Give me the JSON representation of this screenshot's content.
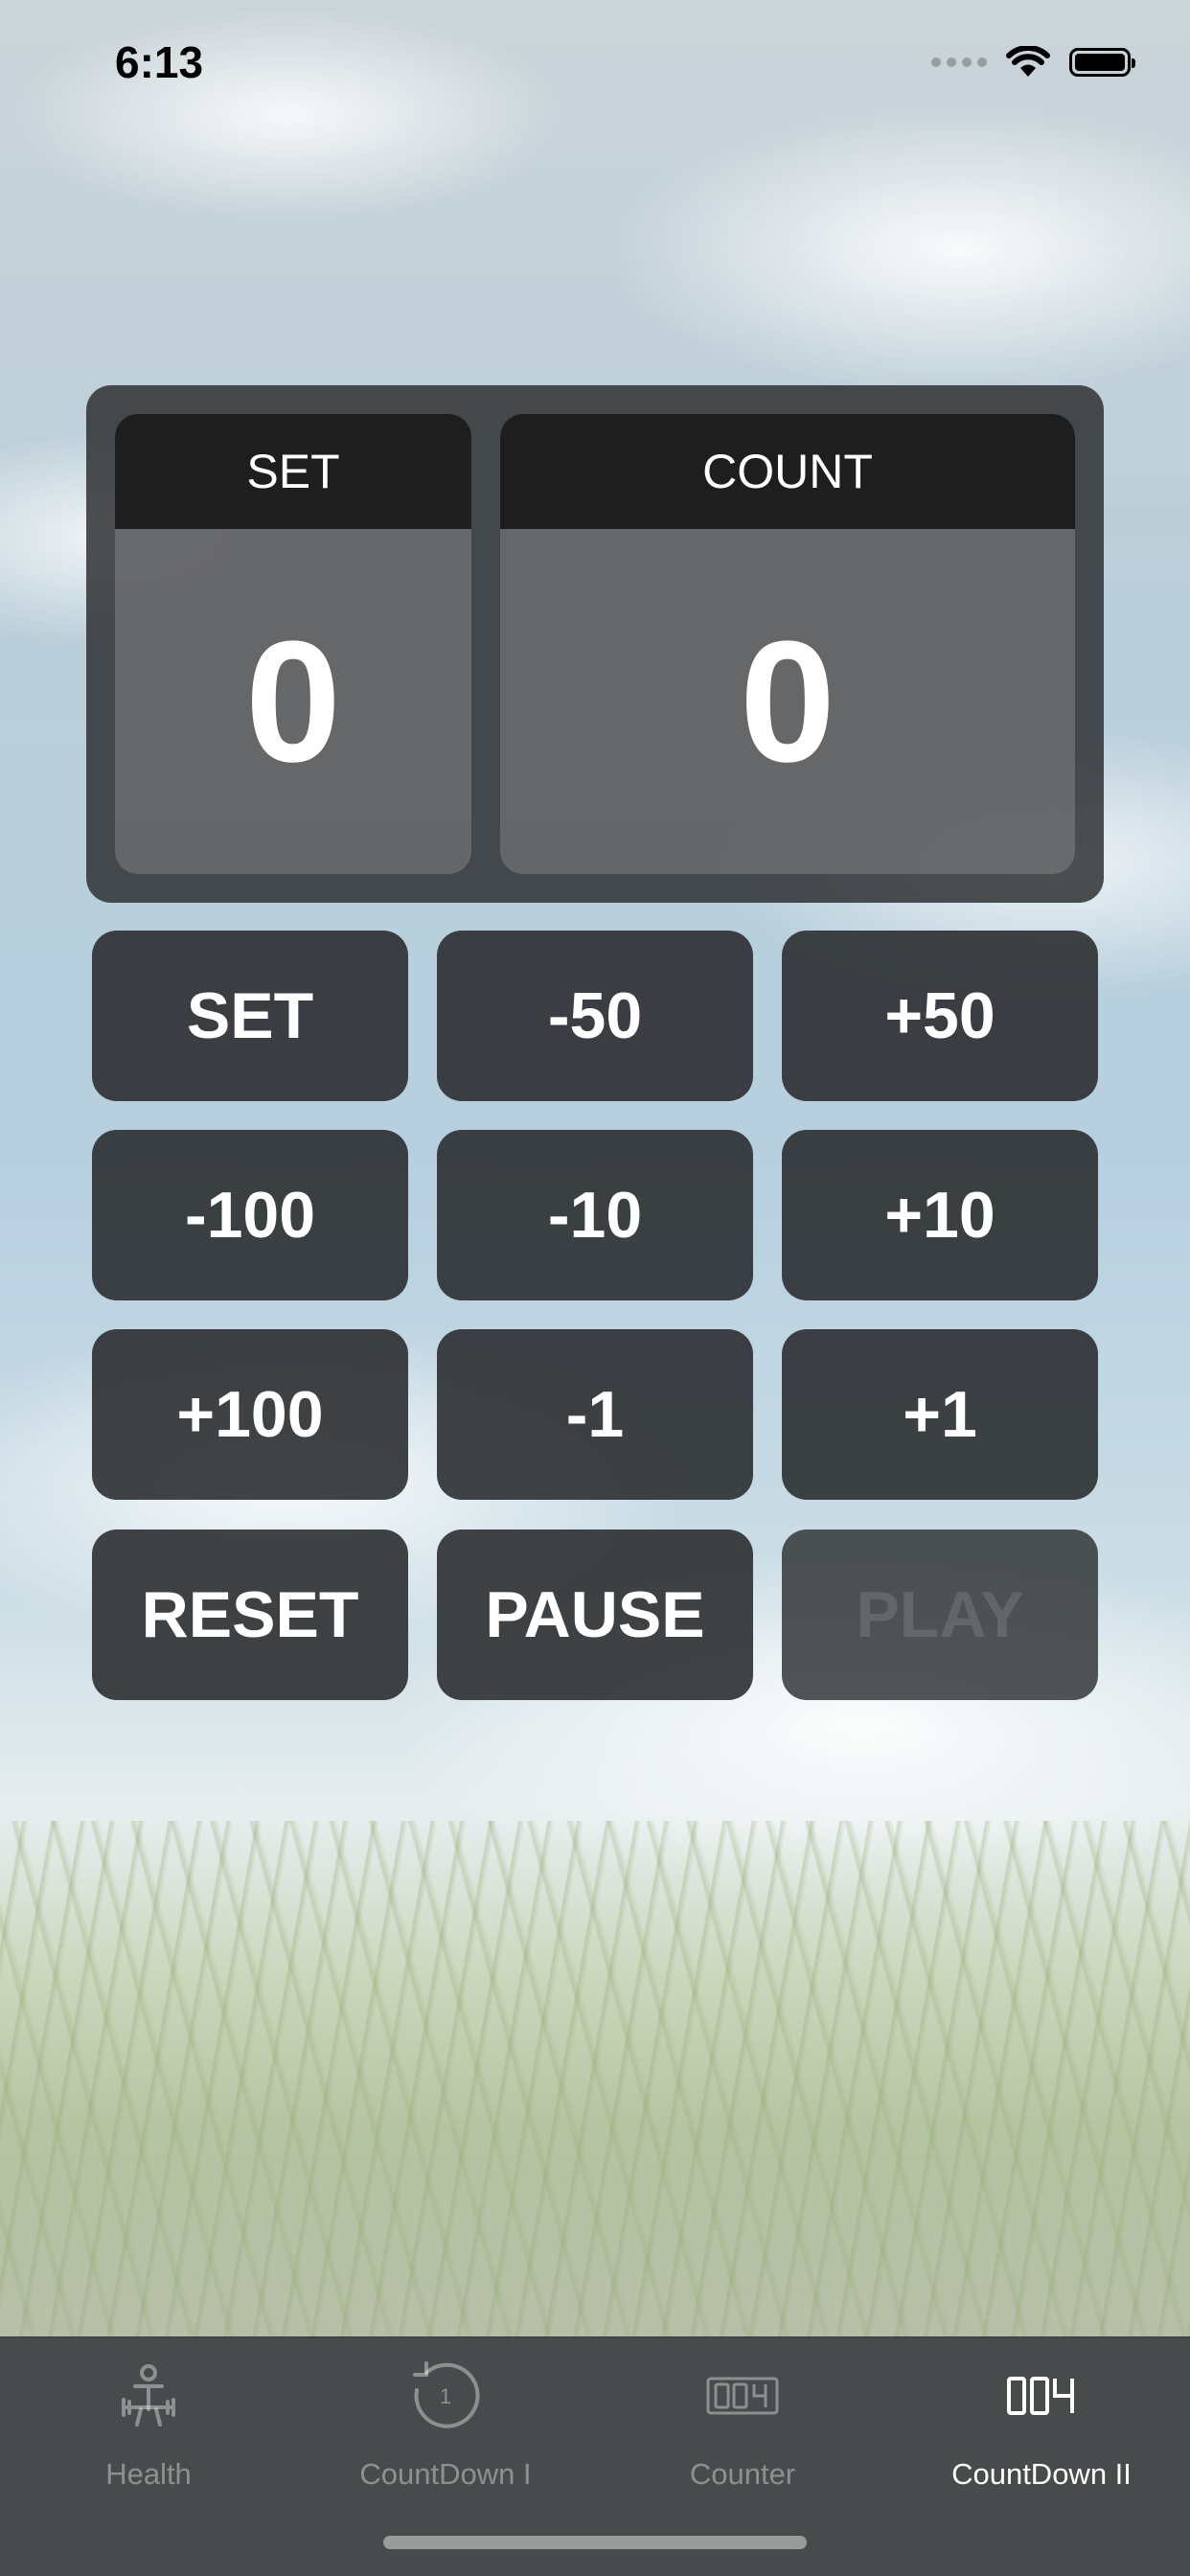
{
  "status_bar": {
    "time": "6:13",
    "icons": [
      "signal-dots-icon",
      "wifi-icon",
      "battery-icon"
    ]
  },
  "scoreboard": {
    "set": {
      "label": "SET",
      "value": "0"
    },
    "count": {
      "label": "COUNT",
      "value": "0"
    }
  },
  "buttons": {
    "set": "SET",
    "minus_50": "-50",
    "plus_50": "+50",
    "minus_100": "-100",
    "minus_10": "-10",
    "plus_10": "+10",
    "plus_100": "+100",
    "minus_1": "-1",
    "plus_1": "+1",
    "reset": "RESET",
    "pause": "PAUSE",
    "play": "PLAY"
  },
  "play_enabled": false,
  "tabbar": {
    "tabs": [
      {
        "label": "Health",
        "icon": "fitness-person-icon",
        "active": false
      },
      {
        "label": "CountDown I",
        "icon": "countdown-timer-icon",
        "active": false
      },
      {
        "label": "Counter",
        "icon": "digital-counter-icon",
        "active": false
      },
      {
        "label": "CountDown II",
        "icon": "digital-counter-icon",
        "active": true
      }
    ]
  },
  "colors": {
    "panel": "#2a2c2e",
    "header": "#1e1e1f",
    "text": "#ffffff",
    "tab_inactive": "#8a8c8e",
    "tab_active": "#ffffff"
  }
}
